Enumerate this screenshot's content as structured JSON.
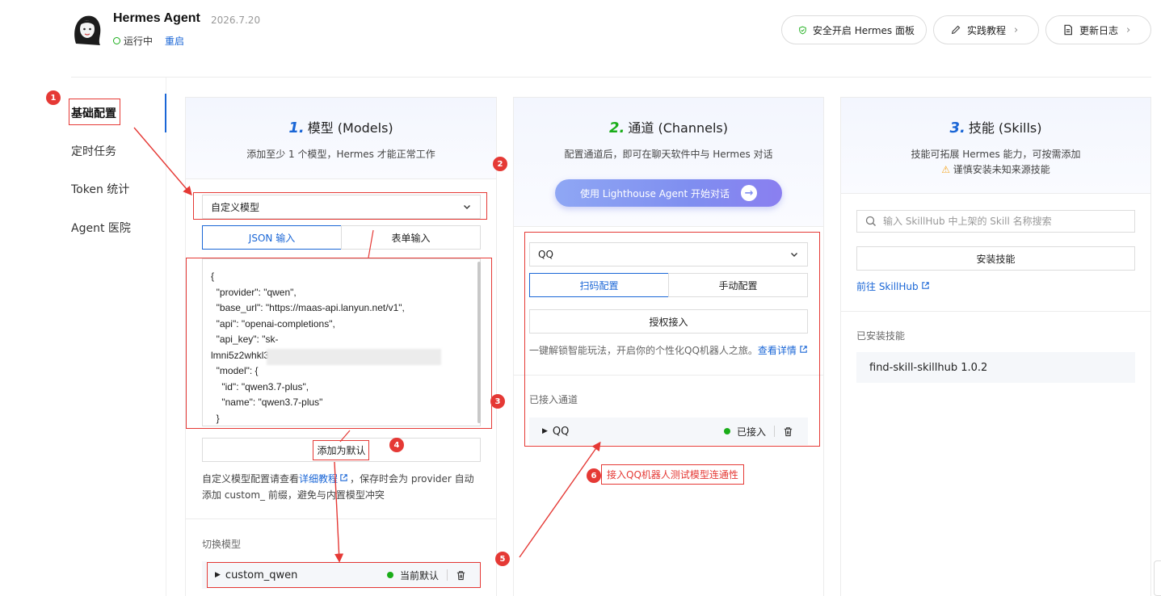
{
  "header": {
    "title": "Hermes Agent",
    "date": "2026.7.20",
    "status": "运行中",
    "restart_label": "重启",
    "buttons": {
      "safe": "安全开启 Hermes 面板",
      "guide": "实践教程",
      "log": "更新日志"
    }
  },
  "sidebar": {
    "items": [
      {
        "label": "基础配置"
      },
      {
        "label": "定时任务"
      },
      {
        "label": "Token 统计"
      },
      {
        "label": "Agent 医院"
      }
    ]
  },
  "models": {
    "num": "1.",
    "title": "模型 (Models)",
    "subtitle": "添加至少 1 个模型，Hermes 才能正常工作",
    "select_value": "自定义模型",
    "tabs": [
      "JSON 输入",
      "表单输入"
    ],
    "json_lines": [
      "{",
      "  \"provider\": \"qwen\",",
      "  \"base_url\": \"https://maas-api.lanyun.net/v1\",",
      "  \"api\": \"openai-completions\",",
      "  \"api_key\": \"sk-",
      "lmni5z2whkl3",
      "  \"model\": {",
      "    \"id\": \"qwen3.7-plus\",",
      "    \"name\": \"qwen3.7-plus\"",
      "  }"
    ],
    "add_default_label": "添加为默认",
    "note_prefix": "自定义模型配置请查看",
    "note_link": "详细教程",
    "note_suffix": "，保存时会为 provider 自动添加 custom_ 前缀，避免与内置模型冲突",
    "switch_label": "切换模型",
    "current": {
      "name": "custom_qwen",
      "status": "当前默认"
    }
  },
  "channels": {
    "num": "2.",
    "title": "通道 (Channels)",
    "subtitle": "配置通道后，即可在聊天软件中与 Hermes 对话",
    "cta_label": "使用 Lighthouse Agent 开始对话",
    "select_value": "QQ",
    "tabs": [
      "扫码配置",
      "手动配置"
    ],
    "authorize_label": "授权接入",
    "note_text": "一键解锁智能玩法，开启你的个性化QQ机器人之旅。",
    "note_link": "查看详情",
    "connected_label": "已接入通道",
    "connected": {
      "name": "QQ",
      "status": "已接入"
    }
  },
  "skills": {
    "num": "3.",
    "title": "技能 (Skills)",
    "subtitle": "技能可拓展 Hermes 能力，可按需添加",
    "warning": "谨慎安装未知来源技能",
    "search_placeholder": "输入 SkillHub 中上架的 Skill 名称搜索",
    "install_label": "安装技能",
    "skillhub_link": "前往 SkillHub",
    "installed_label": "已安装技能",
    "installed": [
      "find-skill-skillhub 1.0.2"
    ]
  },
  "annotations": {
    "badges": [
      "1",
      "2",
      "3",
      "4",
      "5",
      "6"
    ],
    "callout": "接入QQ机器人测试模型连通性"
  },
  "colors": {
    "accent": "#1a66d6",
    "annotation": "#e53935",
    "online": "#1aad19"
  }
}
